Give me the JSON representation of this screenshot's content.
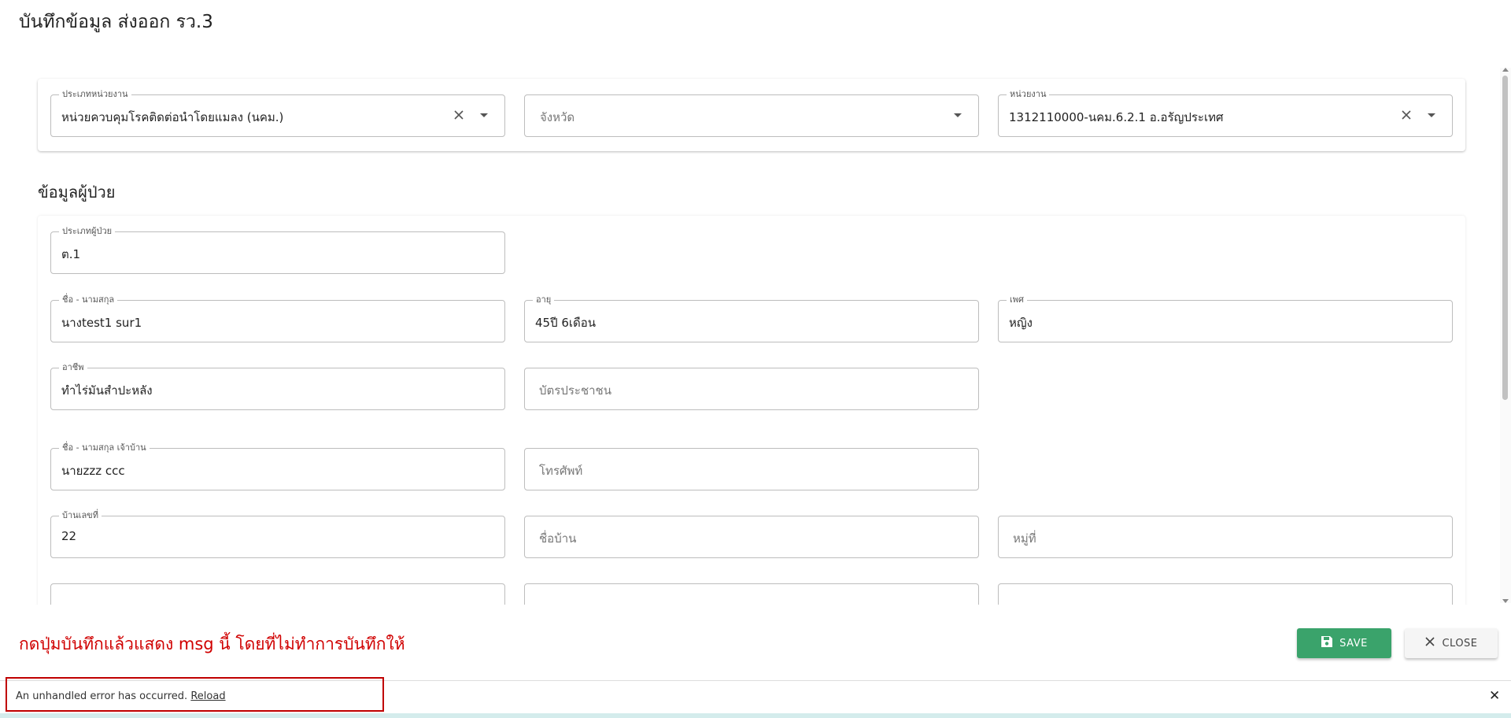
{
  "page": {
    "title": "บันทึกข้อมูล ส่งออก รว.3"
  },
  "filters": {
    "unit_type": {
      "label": "ประเภทหน่วยงาน",
      "value": "หน่วยควบคุมโรคติดต่อนำโดยแมลง (นคม.)"
    },
    "province": {
      "placeholder": "จังหวัด"
    },
    "unit": {
      "label": "หน่วยงาน",
      "value": "1312110000-นคม.6.2.1 อ.อรัญประเทศ"
    }
  },
  "patient": {
    "section_title": "ข้อมูลผู้ป่วย",
    "patient_type": {
      "label": "ประเภทผู้ป่วย",
      "value": "ต.1"
    },
    "full_name": {
      "label": "ชื่อ - นามสกุล",
      "value": "นางtest1 sur1"
    },
    "age": {
      "label": "อายุ",
      "value": "45ปี 6เดือน"
    },
    "gender": {
      "label": "เพศ",
      "value": "หญิง"
    },
    "occupation": {
      "label": "อาชีพ",
      "value": "ทำไร่มันสำปะหลัง"
    },
    "id_card": {
      "placeholder": "บัตรประชาชน"
    },
    "owner_name": {
      "label": "ชื่อ - นามสกุล เจ้าบ้าน",
      "value": "นายzzz ccc"
    },
    "phone": {
      "placeholder": "โทรศัพท์"
    },
    "house_no": {
      "label": "บ้านเลขที่",
      "value": "22"
    },
    "village_name": {
      "placeholder": "ชื่อบ้าน"
    },
    "village_no": {
      "placeholder": "หมู่ที่"
    }
  },
  "annotation": "กดปุ่มบันทึกแล้วแสดง msg นี้ โดยที่ไม่ทำการบันทึกให้",
  "actions": {
    "save_label": "SAVE",
    "close_label": "CLOSE"
  },
  "error_bar": {
    "message": "An unhandled error has occurred.",
    "reload_label": "Reload",
    "dismiss_label": "✕"
  },
  "colors": {
    "save_button": "#3aa36b",
    "annotation_text": "#d00000",
    "highlight_border": "#c00000"
  },
  "icons": {
    "clear": "close-icon",
    "dropdown": "arrow-drop-down-icon",
    "save": "floppy-disk-icon",
    "close": "close-icon"
  }
}
